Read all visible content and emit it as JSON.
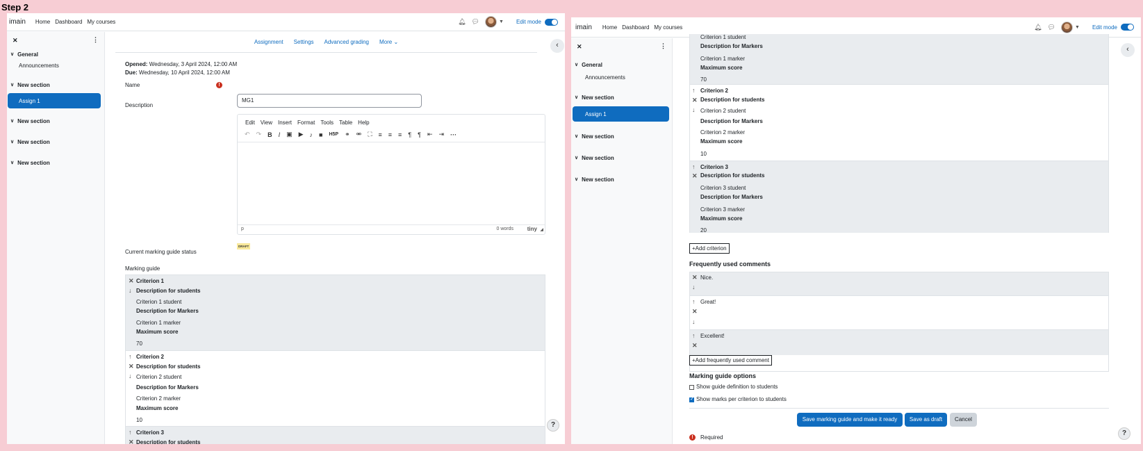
{
  "step_title": "Step 2",
  "nav": {
    "brand": "imain",
    "links": [
      "Home",
      "Dashboard",
      "My courses"
    ],
    "edit_mode": "Edit mode"
  },
  "drawer": {
    "sections": [
      {
        "label": "General",
        "items": [
          "Announcements"
        ]
      },
      {
        "label": "New section",
        "items": [
          "Assign 1"
        ]
      },
      {
        "label": "New section",
        "items": []
      },
      {
        "label": "New section",
        "items": []
      },
      {
        "label": "New section",
        "items": []
      }
    ],
    "active_item": "Assign 1"
  },
  "tabs": [
    "Assignment",
    "Settings",
    "Advanced grading",
    "More"
  ],
  "dates": {
    "opened_label": "Opened:",
    "opened_value": "Wednesday, 3 April 2024, 12:00 AM",
    "due_label": "Due:",
    "due_value": "Wednesday, 10 April 2024, 12:00 AM"
  },
  "form": {
    "name_label": "Name",
    "name_value": "MG1",
    "description_label": "Description",
    "editor_menu": [
      "Edit",
      "View",
      "Insert",
      "Format",
      "Tools",
      "Table",
      "Help"
    ],
    "editor_path": "p",
    "editor_words": "0 words",
    "editor_brand": "tiny",
    "status_label": "Current marking guide status",
    "status_badge": "DRAFT",
    "marking_guide_label": "Marking guide"
  },
  "criteria": [
    {
      "name": "Criterion 1",
      "desc_students_label": "Description for students",
      "desc_students": "Criterion 1 student",
      "desc_markers_label": "Description for Markers",
      "desc_markers": "Criterion 1 marker",
      "max_label": "Maximum score",
      "max": "70"
    },
    {
      "name": "Criterion 2",
      "desc_students_label": "Description for students",
      "desc_students": "Criterion 2 student",
      "desc_markers_label": "Description for Markers",
      "desc_markers": "Criterion 2 marker",
      "max_label": "Maximum score",
      "max": "10"
    },
    {
      "name": "Criterion 3",
      "desc_students_label": "Description for students",
      "desc_students": "Criterion 3 student",
      "desc_markers_label": "Description for Markers",
      "desc_markers": "Criterion 3 marker",
      "max_label": "Maximum score",
      "max": "20"
    }
  ],
  "add_criterion": "Add criterion",
  "comments": {
    "heading": "Frequently used comments",
    "items": [
      "Nice.",
      "Great!",
      "Excellent!"
    ],
    "add_label": "Add frequently used comment"
  },
  "options": {
    "heading": "Marking guide options",
    "items": [
      {
        "label": "Show guide definition to students",
        "checked": false
      },
      {
        "label": "Show marks per criterion to students",
        "checked": true
      }
    ]
  },
  "buttons": {
    "save_ready": "Save marking guide and make it ready",
    "save_draft": "Save as draft",
    "cancel": "Cancel"
  },
  "required_label": "Required",
  "help_symbol": "?",
  "colors": {
    "primary": "#0f6cbf",
    "background": "#f7cdd4",
    "draft_badge": "#f8e89a",
    "error": "#ca3120"
  }
}
